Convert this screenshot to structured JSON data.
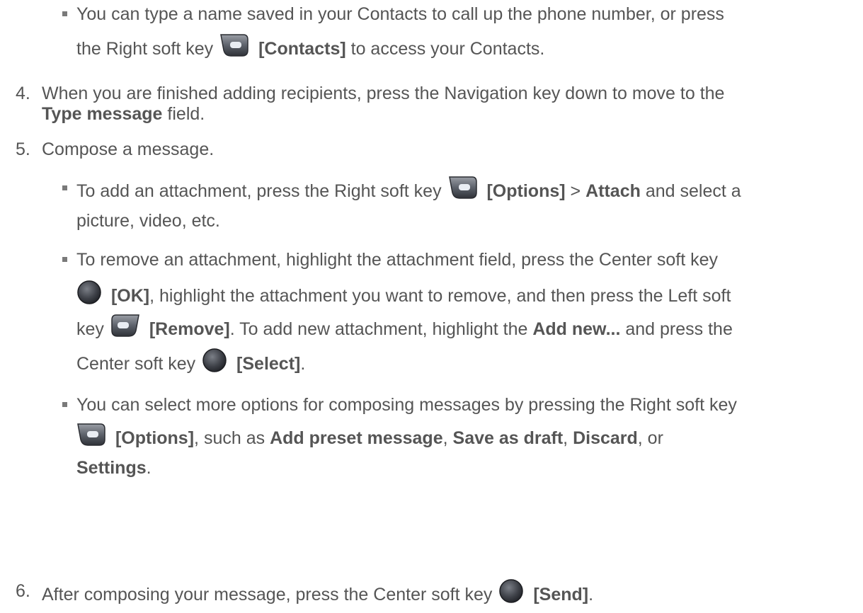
{
  "bullet_contacts": {
    "line1": "You can type a name saved in your Contacts to call up the phone number, or press",
    "pre": "the Right soft key",
    "label": "[Contacts]",
    "post": "to access your Contacts."
  },
  "step4": {
    "number": "4.",
    "line1": "When you are finished adding recipients, press the Navigation key down to move to the",
    "field": "Type message",
    "post": "field."
  },
  "step5": {
    "number": "5.",
    "text": "Compose a message."
  },
  "bullet_attach": {
    "pre": "To add an attachment, press the Right soft key",
    "label": "[Options]",
    "sep": ">",
    "attach": "Attach",
    "post": "and select a",
    "line2": "picture, video, etc."
  },
  "bullet_remove": {
    "line1": "To remove an attachment, highlight the attachment field, press the Center soft key",
    "ok": "[OK]",
    "line2_post": ", highlight the attachment you want to remove, and then press the Left soft",
    "key_pre": "key",
    "remove": "[Remove]",
    "mid": ". To add new attachment, highlight the",
    "add_new": "Add new...",
    "post": "and press the",
    "center_pre": "Center soft key",
    "select": "[Select]",
    "end": "."
  },
  "bullet_options": {
    "line1": "You can select more options for composing messages by pressing the Right soft key",
    "options": "[Options]",
    "such_as": ", such as",
    "preset": "Add preset message",
    "c1": ",",
    "draft": "Save as draft",
    "c2": ",",
    "discard": "Discard",
    "or": ", or",
    "settings": "Settings",
    "end": "."
  },
  "step6": {
    "number": "6.",
    "pre": "After composing your message, press the Center soft key",
    "send": "[Send]",
    "end": "."
  },
  "icons": {
    "right_soft_key": "right-soft-key-icon",
    "left_soft_key": "left-soft-key-icon",
    "center_soft_key": "center-soft-key-icon"
  },
  "colors": {
    "text": "#555555",
    "bullet": "#7a7a7a"
  }
}
